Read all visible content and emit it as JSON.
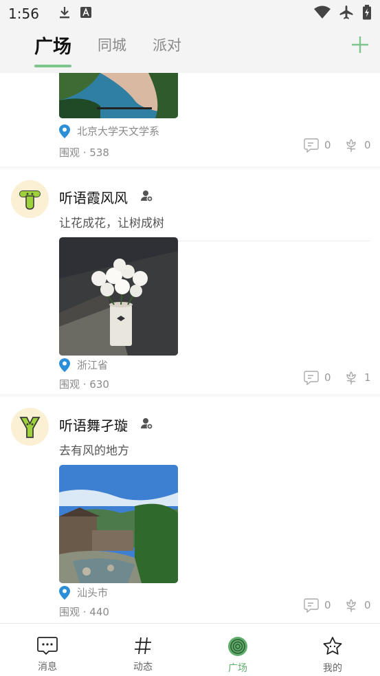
{
  "status_bar": {
    "time": "1:56"
  },
  "tabs": [
    {
      "label": "广场",
      "active": true
    },
    {
      "label": "同城",
      "active": false
    },
    {
      "label": "派对",
      "active": false
    }
  ],
  "accent_color": "#7fc48c",
  "posts": [
    {
      "name": "",
      "content": "",
      "location": "北京大学天文学系",
      "views": "围观 · 538",
      "comments": "0",
      "likes": "0",
      "photo": "beach-coast-photo"
    },
    {
      "name": "听语霞风风",
      "content": "让花成花，让树成树",
      "location": "浙江省",
      "views": "围观 · 630",
      "comments": "0",
      "likes": "1",
      "photo": "flowers-in-cup-photo"
    },
    {
      "name": "听语舞孑璇",
      "content": "去有风的地方",
      "location": "汕头市",
      "views": "围观 · 440",
      "comments": "0",
      "likes": "0",
      "photo": "village-stream-photo"
    }
  ],
  "bottom_nav": [
    {
      "label": "消息",
      "icon": "message-icon"
    },
    {
      "label": "动态",
      "icon": "hashtag-icon"
    },
    {
      "label": "广场",
      "icon": "square-spiral-icon",
      "active": true
    },
    {
      "label": "我的",
      "icon": "star-face-icon"
    }
  ]
}
